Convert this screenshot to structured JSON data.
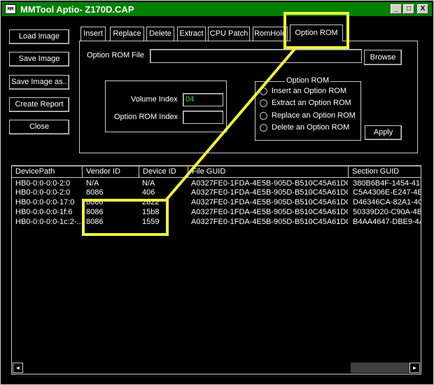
{
  "window": {
    "title": "MMTool Aptio- Z170D.CAP",
    "icon_text": "MM",
    "controls": {
      "minimize": "_",
      "maximize": "□",
      "close": "X"
    }
  },
  "left_buttons": [
    "Load Image",
    "Save Image",
    "Save Image as..",
    "Create Report",
    "Close"
  ],
  "tabs": [
    "Insert",
    "Replace",
    "Delete",
    "Extract",
    "CPU Patch",
    "RomHole",
    "Option ROM"
  ],
  "active_tab": "Option ROM",
  "option_rom_panel": {
    "file_label": "Option ROM File",
    "file_value": "",
    "browse_label": "Browse",
    "volume_index_label": "Volume Index",
    "volume_index_value": "04",
    "option_rom_index_label": "Option ROM Index",
    "option_rom_index_value": "",
    "group_title": "Option ROM",
    "radios": [
      "Insert an Option ROM",
      "Extract an Option ROM",
      "Replace an Option ROM",
      "Delete an Option ROM"
    ],
    "apply_label": "Apply"
  },
  "table": {
    "columns": [
      "DevicePath",
      "Vendor ID",
      "Device ID",
      "File GUID",
      "Section GUID"
    ],
    "rows": [
      [
        "HB0-0:0-0:0-2:0",
        "N/A",
        "N/A",
        "A0327FE0-1FDA-4E5B-905D-B510C45A61D0",
        "380B6B4F-1454-41F"
      ],
      [
        "HB0-0:0-0:0-2:0",
        "8086",
        "406",
        "A0327FE0-1FDA-4E5B-905D-B510C45A61D0",
        "C5A4306E-E247-4E0"
      ],
      [
        "HB0-0:0-0:0-17:0",
        "8086",
        "2822",
        "A0327FE0-1FDA-4E5B-905D-B510C45A61D0",
        "D46346CA-82A1-4CI"
      ],
      [
        "HB0-0:0-0:0-1f:6",
        "8086",
        "15b8",
        "A0327FE0-1FDA-4E5B-905D-B510C45A61D0",
        "50339D20-C90A-4BB"
      ],
      [
        "HB0-0:0-0:0-1c:2-...",
        "8086",
        "1559",
        "A0327FE0-1FDA-4E5B-905D-B510C45A61D0",
        "B4AA4647-DBE9-4A"
      ]
    ],
    "scroll_left": "◄",
    "scroll_right": "►"
  },
  "colors": {
    "background": "#000000",
    "titlebar": "#008000",
    "highlight": "#f2f23c",
    "volume_text": "#3fd63f"
  }
}
